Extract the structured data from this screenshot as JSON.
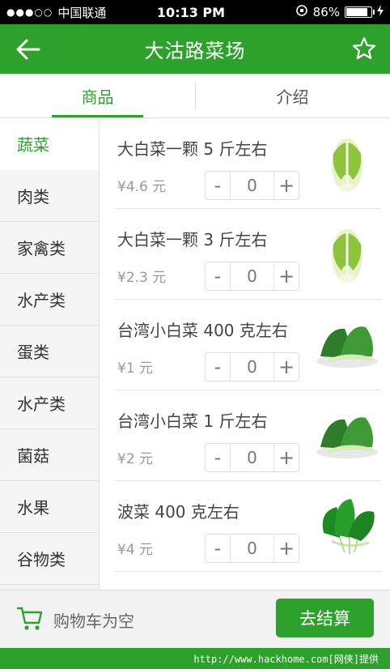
{
  "status_bar": {
    "signal": "●●●○○",
    "carrier": "中国联通",
    "time": "10:13 PM",
    "battery": "86%",
    "battery_level": 0.86
  },
  "header": {
    "title": "大沽路菜场"
  },
  "tabs": [
    {
      "label": "商品",
      "active": true
    },
    {
      "label": "介绍",
      "active": false
    }
  ],
  "sidebar": {
    "items": [
      {
        "label": "蔬菜",
        "active": true
      },
      {
        "label": "肉类",
        "active": false
      },
      {
        "label": "家禽类",
        "active": false
      },
      {
        "label": "水产类",
        "active": false
      },
      {
        "label": "蛋类",
        "active": false
      },
      {
        "label": "水产类",
        "active": false
      },
      {
        "label": "菌菇",
        "active": false
      },
      {
        "label": "水果",
        "active": false
      },
      {
        "label": "谷物类",
        "active": false
      }
    ]
  },
  "products": [
    {
      "name": "大白菜一颗 5 斤左右",
      "price": "¥4.6 元",
      "qty": "0",
      "image": "napa-cabbage"
    },
    {
      "name": "大白菜一颗 3 斤左右",
      "price": "¥2.3 元",
      "qty": "0",
      "image": "napa-cabbage"
    },
    {
      "name": "台湾小白菜 400 克左右",
      "price": "¥1 元",
      "qty": "0",
      "image": "bok-choy"
    },
    {
      "name": "台湾小白菜 1 斤左右",
      "price": "¥2 元",
      "qty": "0",
      "image": "bok-choy"
    },
    {
      "name": "波菜 400 克左右",
      "price": "¥4 元",
      "qty": "0",
      "image": "spinach"
    }
  ],
  "stepper": {
    "minus": "-",
    "plus": "+"
  },
  "cart": {
    "empty_text": "购物车为空",
    "checkout_label": "去结算"
  },
  "footer": {
    "watermark": "http://www.hackhome.com[网侠]提供"
  },
  "colors": {
    "brand_green": "#2da12c",
    "sidebar_bg": "#f5f5f5",
    "cart_bar_bg": "#f2f2f2"
  }
}
